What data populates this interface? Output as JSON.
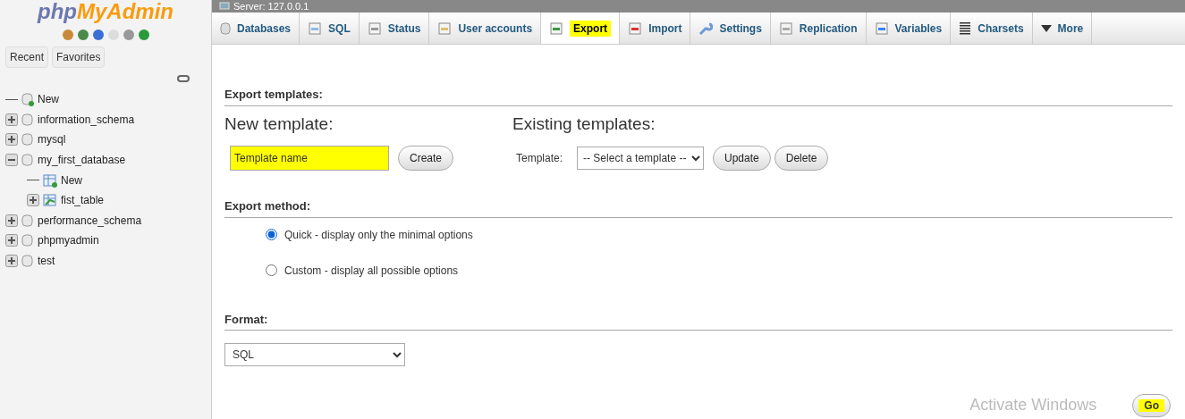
{
  "sidebar": {
    "logo_left": "php",
    "logo_right": "MyAdmin",
    "buttons": [
      {
        "label": "Recent"
      },
      {
        "label": "Favorites"
      }
    ],
    "tree": [
      {
        "label": "New",
        "kind": "new-db"
      },
      {
        "label": "information_schema",
        "kind": "db",
        "expanded": false
      },
      {
        "label": "mysql",
        "kind": "db",
        "expanded": false
      },
      {
        "label": "my_first_database",
        "kind": "db",
        "expanded": true,
        "children": [
          {
            "label": "New",
            "kind": "new-table"
          },
          {
            "label": "fist_table",
            "kind": "table",
            "expanded": false
          }
        ]
      },
      {
        "label": "performance_schema",
        "kind": "db",
        "expanded": false
      },
      {
        "label": "phpmyadmin",
        "kind": "db",
        "expanded": false
      },
      {
        "label": "test",
        "kind": "db",
        "expanded": false
      }
    ]
  },
  "server_bar": {
    "title": "Server: 127.0.0.1"
  },
  "tabs": [
    {
      "label": "Databases",
      "kind": "databases",
      "selected": false,
      "highlighted": false
    },
    {
      "label": "SQL",
      "kind": "sql",
      "selected": false,
      "highlighted": false
    },
    {
      "label": "Status",
      "kind": "status",
      "selected": false,
      "highlighted": false
    },
    {
      "label": "User accounts",
      "kind": "users",
      "selected": false,
      "highlighted": false
    },
    {
      "label": "Export",
      "kind": "export",
      "selected": true,
      "highlighted": true
    },
    {
      "label": "Import",
      "kind": "import",
      "selected": false,
      "highlighted": false
    },
    {
      "label": "Settings",
      "kind": "settings",
      "selected": false,
      "highlighted": false
    },
    {
      "label": "Replication",
      "kind": "replication",
      "selected": false,
      "highlighted": false
    },
    {
      "label": "Variables",
      "kind": "variables",
      "selected": false,
      "highlighted": false
    },
    {
      "label": "Charsets",
      "kind": "charsets",
      "selected": false,
      "highlighted": false
    },
    {
      "label": "More",
      "kind": "more",
      "selected": false,
      "highlighted": false
    }
  ],
  "export_templates": {
    "heading": "Export templates:",
    "new_title": "New template:",
    "name_field": {
      "placeholder": "Template name",
      "highlighted": true
    },
    "create": "Create",
    "existing_title": "Existing templates:",
    "template_label": "Template:",
    "template_select": "-- Select a template --",
    "update": "Update",
    "delete": "Delete"
  },
  "export_method": {
    "heading": "Export method:",
    "options": [
      {
        "label": "Quick - display only the minimal options",
        "selected": true
      },
      {
        "label": "Custom - display all possible options",
        "selected": false
      }
    ]
  },
  "format": {
    "heading": "Format:",
    "value": "SQL"
  },
  "go": {
    "label": "Go",
    "highlighted": true
  },
  "os_notice": "Activate Windows"
}
